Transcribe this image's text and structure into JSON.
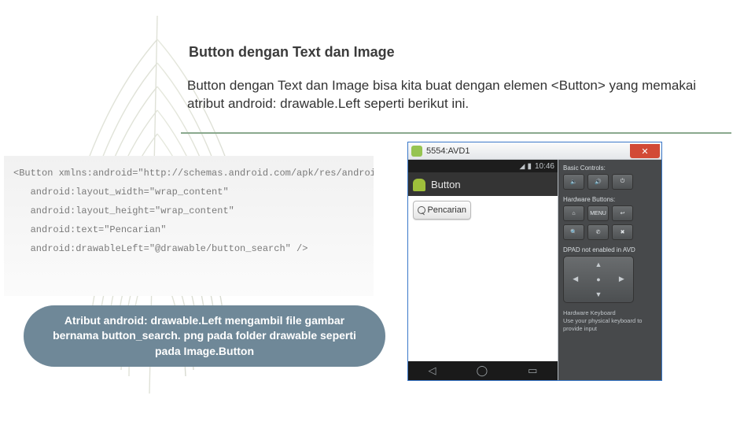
{
  "title": "Button dengan Text dan Image",
  "paragraph": "Button dengan Text dan Image bisa kita buat dengan elemen <Button> yang memakai atribut android: drawable.Left seperti berikut ini.",
  "code": {
    "line1": "<Button xmlns:android=\"http://schemas.android.com/apk/res/android\"",
    "line2": "   android:layout_width=\"wrap_content\"",
    "line3": "   android:layout_height=\"wrap_content\"",
    "line4": "   android:text=\"Pencarian\"",
    "line5": "   android:drawableLeft=\"@drawable/button_search\" />"
  },
  "callout": "Atribut android: drawable.Left mengambil file gambar bernama button_search. png pada folder drawable seperti pada Image.Button",
  "emulator": {
    "window_title": "5554:AVD1",
    "close_label": "✕",
    "status_time": "10:46",
    "app_title": "Button",
    "button_label": "Pencarian",
    "nav": {
      "back": "◁",
      "home": "◯",
      "recent": "▭"
    },
    "side": {
      "basic_label": "Basic Controls:",
      "hw_label": "Hardware Buttons:",
      "menu": "MENU",
      "dpad_label": "DPAD not enabled in AVD",
      "kb_title": "Hardware Keyboard",
      "kb_sub": "Use your physical keyboard to provide input"
    }
  }
}
